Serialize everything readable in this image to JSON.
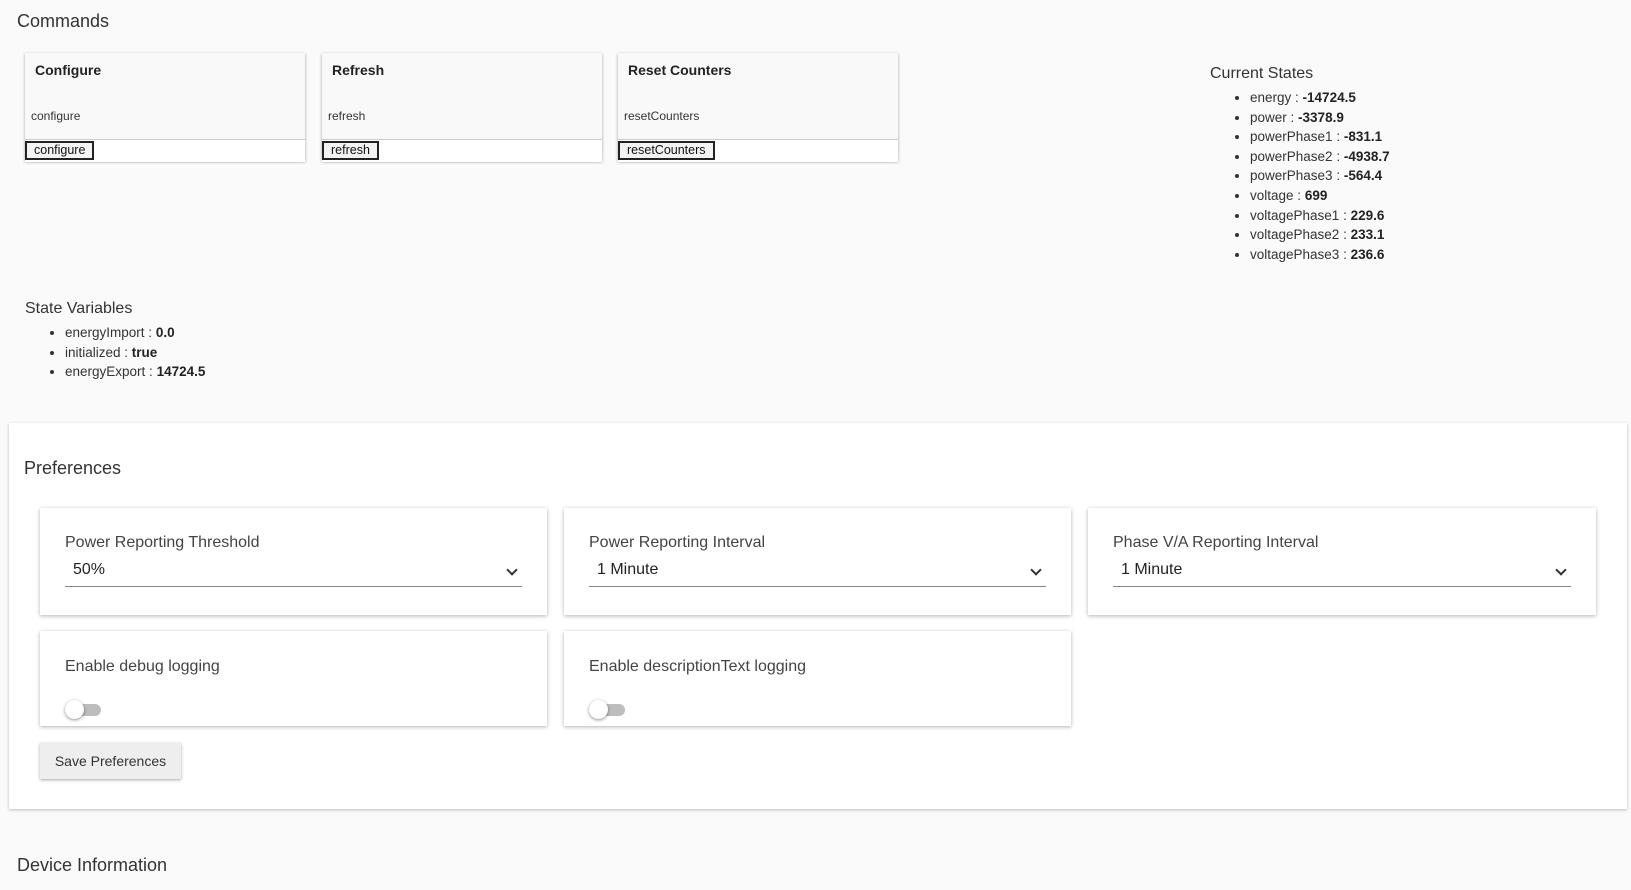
{
  "commands": {
    "title": "Commands",
    "items": [
      {
        "name": "Configure",
        "method": "configure",
        "button": "configure"
      },
      {
        "name": "Refresh",
        "method": "refresh",
        "button": "refresh"
      },
      {
        "name": "Reset Counters",
        "method": "resetCounters",
        "button": "resetCounters"
      }
    ]
  },
  "current_states": {
    "title": "Current States",
    "items": [
      {
        "key": "energy",
        "value": "-14724.5"
      },
      {
        "key": "power",
        "value": "-3378.9"
      },
      {
        "key": "powerPhase1",
        "value": "-831.1"
      },
      {
        "key": "powerPhase2",
        "value": "-4938.7"
      },
      {
        "key": "powerPhase3",
        "value": "-564.4"
      },
      {
        "key": "voltage",
        "value": "699"
      },
      {
        "key": "voltagePhase1",
        "value": "229.6"
      },
      {
        "key": "voltagePhase2",
        "value": "233.1"
      },
      {
        "key": "voltagePhase3",
        "value": "236.6"
      }
    ]
  },
  "state_variables": {
    "title": "State Variables",
    "items": [
      {
        "key": "energyImport",
        "value": "0.0"
      },
      {
        "key": "initialized",
        "value": "true"
      },
      {
        "key": "energyExport",
        "value": "14724.5"
      }
    ]
  },
  "preferences": {
    "title": "Preferences",
    "selects": [
      {
        "label": "Power Reporting Threshold",
        "value": "50%"
      },
      {
        "label": "Power Reporting Interval",
        "value": "1 Minute"
      },
      {
        "label": "Phase V/A Reporting Interval",
        "value": "1 Minute"
      }
    ],
    "toggles": [
      {
        "label": "Enable debug logging",
        "on": false
      },
      {
        "label": "Enable descriptionText logging",
        "on": false
      }
    ],
    "save_label": "Save Preferences"
  },
  "device_info": {
    "title": "Device Information"
  }
}
